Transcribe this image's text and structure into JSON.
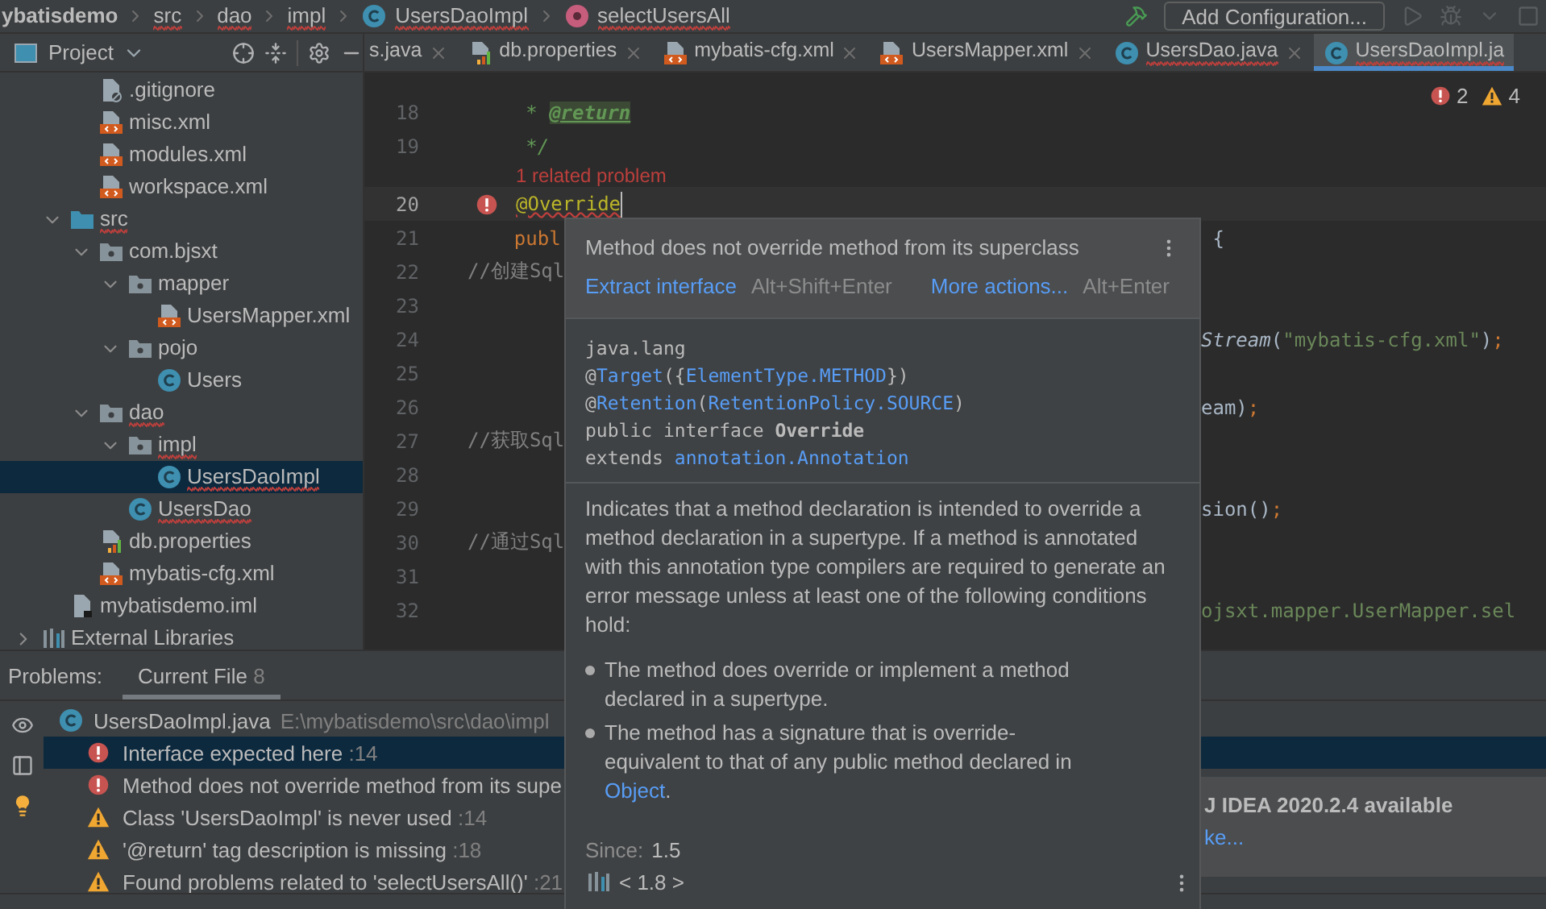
{
  "breadcrumb": [
    {
      "label": "ybatisdemo",
      "kind": "project",
      "error": false
    },
    {
      "label": "src",
      "kind": "folder",
      "error": true
    },
    {
      "label": "dao",
      "kind": "folder",
      "error": true
    },
    {
      "label": "impl",
      "kind": "folder",
      "error": true
    },
    {
      "label": "UsersDaoImpl",
      "kind": "class",
      "error": true
    },
    {
      "label": "selectUsersAll",
      "kind": "method",
      "error": true
    }
  ],
  "toolbar": {
    "run_config": "Add Configuration..."
  },
  "project_panel": {
    "title": "Project"
  },
  "tabs": [
    {
      "label": "s.java",
      "kind": "none",
      "selected": false,
      "error": false
    },
    {
      "label": "db.properties",
      "kind": "properties",
      "selected": false,
      "error": false
    },
    {
      "label": "mybatis-cfg.xml",
      "kind": "xml",
      "selected": false,
      "error": false
    },
    {
      "label": "UsersMapper.xml",
      "kind": "xml",
      "selected": false,
      "error": false
    },
    {
      "label": "UsersDao.java",
      "kind": "class",
      "selected": false,
      "error": true
    },
    {
      "label": "UsersDaoImpl.ja",
      "kind": "class",
      "selected": true,
      "error": true
    }
  ],
  "inspection": {
    "errors": "2",
    "warnings": "4"
  },
  "tree": [
    {
      "children": [
        {
          "children": [
            {
              "label": ".gitignore",
              "kind": "ignore",
              "selected": false,
              "error": false
            },
            {
              "label": "misc.xml",
              "kind": "xml",
              "selected": false,
              "error": false
            },
            {
              "label": "modules.xml",
              "kind": "xml",
              "selected": false,
              "error": false
            },
            {
              "label": "workspace.xml",
              "kind": "xml",
              "selected": false,
              "error": false
            }
          ]
        },
        {
          "label": "src",
          "kind": "source",
          "expanded": true,
          "selected": false,
          "error": true,
          "children": [
            {
              "label": "com.bjsxt",
              "kind": "package",
              "expanded": true,
              "selected": false,
              "error": false,
              "children": [
                {
                  "label": "mapper",
                  "kind": "package",
                  "expanded": true,
                  "selected": false,
                  "error": false,
                  "children": [
                    {
                      "label": "UsersMapper.xml",
                      "kind": "xml",
                      "selected": false,
                      "error": false
                    }
                  ]
                },
                {
                  "label": "pojo",
                  "kind": "package",
                  "expanded": true,
                  "selected": false,
                  "error": false,
                  "children": [
                    {
                      "label": "Users",
                      "kind": "class",
                      "selected": false,
                      "error": false
                    }
                  ]
                }
              ]
            },
            {
              "label": "dao",
              "kind": "package",
              "expanded": true,
              "selected": false,
              "error": true,
              "children": [
                {
                  "label": "impl",
                  "kind": "package",
                  "expanded": true,
                  "selected": false,
                  "error": true,
                  "children": [
                    {
                      "label": "UsersDaoImpl",
                      "kind": "class",
                      "selected": true,
                      "error": true
                    }
                  ]
                },
                {
                  "label": "UsersDao",
                  "kind": "class",
                  "selected": false,
                  "error": true
                }
              ]
            },
            {
              "label": "db.properties",
              "kind": "properties",
              "selected": false,
              "error": false
            },
            {
              "label": "mybatis-cfg.xml",
              "kind": "xml",
              "selected": false,
              "error": false
            }
          ]
        },
        {
          "label": "mybatisdemo.iml",
          "kind": "iml",
          "selected": false,
          "error": false
        }
      ]
    },
    {
      "label": "External Libraries",
      "kind": "libraries",
      "expanded": false,
      "selected": false,
      "error": false
    }
  ],
  "code_lines": [
    {
      "kind": "line",
      "number": "18",
      "current": false,
      "segments": [
        {
          "text": "     * ",
          "kind": "doc"
        },
        {
          "text": "@return",
          "kind": "doc_tag"
        }
      ]
    },
    {
      "kind": "line",
      "number": "19",
      "current": false,
      "segments": [
        {
          "text": "     */",
          "kind": "doc"
        }
      ]
    },
    {
      "kind": "inlay",
      "text": "1 related problem"
    },
    {
      "kind": "line",
      "number": "20",
      "current": true,
      "error_marker": true,
      "segments": [
        {
          "text": "@Override",
          "kind": "annotation"
        }
      ]
    },
    {
      "kind": "line",
      "number": "21",
      "current": false,
      "segments": [
        {
          "text": "    publ",
          "kind": "keyword"
        }
      ],
      "right_segments": [
        {
          "text": " {",
          "kind": "plain"
        }
      ]
    },
    {
      "kind": "line",
      "number": "22",
      "current": false,
      "segments": [
        {
          "text": "//创建Sql",
          "kind": "comment"
        }
      ]
    },
    {
      "kind": "line",
      "number": "23",
      "current": false
    },
    {
      "kind": "line",
      "number": "24",
      "current": false,
      "right_segments": [
        {
          "text": "Stream",
          "kind": "italic"
        },
        {
          "text": "(",
          "kind": "plain"
        },
        {
          "text": "\"mybatis-cfg.xml\"",
          "kind": "string"
        },
        {
          "text": ")",
          "kind": "plain"
        },
        {
          "text": ";",
          "kind": "keyword"
        }
      ]
    },
    {
      "kind": "line",
      "number": "25",
      "current": false
    },
    {
      "kind": "line",
      "number": "26",
      "current": false,
      "right_segments": [
        {
          "text": "eam)",
          "kind": "plain"
        },
        {
          "text": ";",
          "kind": "keyword"
        }
      ]
    },
    {
      "kind": "line",
      "number": "27",
      "current": false,
      "segments": [
        {
          "text": "//获取Sql",
          "kind": "comment"
        }
      ]
    },
    {
      "kind": "line",
      "number": "28",
      "current": false
    },
    {
      "kind": "line",
      "number": "29",
      "current": false,
      "right_segments": [
        {
          "text": "sion()",
          "kind": "plain"
        },
        {
          "text": ";",
          "kind": "keyword"
        }
      ]
    },
    {
      "kind": "line",
      "number": "30",
      "current": false,
      "segments": [
        {
          "text": "//通过Sql",
          "kind": "comment"
        }
      ]
    },
    {
      "kind": "line",
      "number": "31",
      "current": false
    },
    {
      "kind": "line",
      "number": "32",
      "current": false,
      "right_segments": [
        {
          "text": "ojsxt.mapper.UserMapper.sel",
          "kind": "string"
        }
      ]
    }
  ],
  "quick_doc": {
    "title": "Method does not override method from its superclass",
    "actions": [
      {
        "label": "Extract interface",
        "shortcut": "Alt+Shift+Enter"
      },
      {
        "label": "More actions...",
        "shortcut": "Alt+Enter"
      }
    ],
    "signature": [
      [
        {
          "text": "java.lang",
          "kind": "plain"
        }
      ],
      [
        {
          "text": "@",
          "kind": "plain"
        },
        {
          "text": "Target",
          "kind": "link"
        },
        {
          "text": "({",
          "kind": "plain"
        },
        {
          "text": "ElementType.METHOD",
          "kind": "link"
        },
        {
          "text": "})",
          "kind": "plain"
        }
      ],
      [
        {
          "text": "@",
          "kind": "plain"
        },
        {
          "text": "Retention",
          "kind": "link"
        },
        {
          "text": "(",
          "kind": "plain"
        },
        {
          "text": "RetentionPolicy.SOURCE",
          "kind": "link"
        },
        {
          "text": ")",
          "kind": "plain"
        }
      ],
      [
        {
          "text": "public interface ",
          "kind": "plain"
        },
        {
          "text": "Override",
          "kind": "bold"
        }
      ],
      [
        {
          "text": "extends ",
          "kind": "plain"
        },
        {
          "text": "annotation.Annotation",
          "kind": "link"
        }
      ]
    ],
    "description": "Indicates that a method declaration is intended to override a method declaration in a supertype. If a method is annotated with this annotation type compilers are required to generate an error message unless at least one of the following conditions hold:",
    "conditions": [
      [
        {
          "text": "The method does override or implement a method declared in a supertype.",
          "kind": "plain"
        }
      ],
      [
        {
          "text": "The method has a signature that is override-equivalent to that of any public method declared in ",
          "kind": "plain"
        },
        {
          "text": "Object",
          "kind": "link"
        },
        {
          "text": ".",
          "kind": "plain"
        }
      ]
    ],
    "since_label": "Since:",
    "since": "1.5",
    "version": "< 1.8 >"
  },
  "problems": {
    "title": "Problems:",
    "tabs": [
      {
        "label": "Current File",
        "count": "8",
        "selected": true
      }
    ],
    "file": {
      "name": "UsersDaoImpl.java",
      "path": "E:\\mybatisdemo\\src\\dao\\impl"
    },
    "items": [
      {
        "kind": "error",
        "text": "Interface expected here",
        "line": ":14",
        "selected": true
      },
      {
        "kind": "error",
        "text": "Method does not override method from its supe",
        "selected": false
      },
      {
        "kind": "warning",
        "text": "Class 'UsersDaoImpl' is never used",
        "line": ":14",
        "selected": false
      },
      {
        "kind": "warning",
        "text": "'@return' tag description is missing",
        "line": ":18",
        "selected": false
      },
      {
        "kind": "warning",
        "text": "Found problems related to 'selectUsersAll()'",
        "line": ":21",
        "selected": false
      }
    ]
  },
  "notification": {
    "title": "J IDEA 2020.2.4 available",
    "link": "ke..."
  }
}
